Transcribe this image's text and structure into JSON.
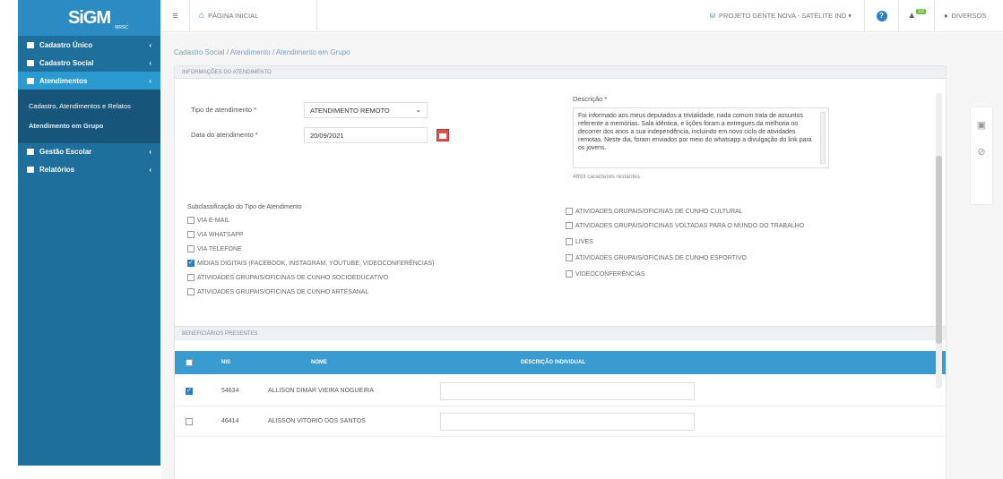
{
  "sidebar": {
    "logo": "SiGM",
    "logo_sub": "MRSC",
    "items": [
      {
        "label": "Cadastro Único",
        "chevron": "‹"
      },
      {
        "label": "Cadastro Social",
        "chevron": "‹"
      },
      {
        "label": "Atendimentos",
        "chevron": "‹"
      },
      {
        "label": "Gestão Escolar",
        "chevron": "‹"
      },
      {
        "label": "Relatórios",
        "chevron": "‹"
      }
    ],
    "submenu": [
      {
        "label": "Cadastro, Atendimentos e Relatos"
      },
      {
        "label": "Atendimento em Grupo"
      }
    ]
  },
  "topbar": {
    "menu_icon": "≡",
    "home_label": "PÁGINA INICIAL",
    "project_label": "PROJETO GENTE NOVA - SATÉLITE IND ▾",
    "notif_count": "12",
    "user_label": "DIVERSOS"
  },
  "breadcrumb": "Cadastro Social / Atendimento / Atendimento em Grupo",
  "form": {
    "section_title": "INFORMAÇÕES DO ATENDIMENTO",
    "tipo_label": "Tipo de atendimento *",
    "tipo_value": "ATENDIMENTO REMOTO",
    "data_label": "Data do atendimento *",
    "data_value": "20/09/2021",
    "descricao_label": "Descrição *",
    "descricao_value": "Foi informado aos meus deputados a trivialidade, nada comum trata de assuntos referente a memórias. Sala idêntica, e lições foram a entregues da melhoria no decorrer dos anos a sua independência, incluindo em novo ciclo de atividades remotas. Neste dia, foram enviados por meio do whatsapp a divulgação do link para os jovens.",
    "counter": "4893 caracteres restantes",
    "modalidades_label": "Subclassificação do Tipo de Atendimento",
    "options_left": [
      {
        "label": "VIA E-MAIL",
        "checked": false
      },
      {
        "label": "VIA WHATSAPP",
        "checked": false
      },
      {
        "label": "VIA TELEFONE",
        "checked": false
      },
      {
        "label": "MÍDIAS DIGITAIS (FACEBOOK, INSTAGRAM, YOUTUBE, VIDEOCONFERÊNCIAS)",
        "checked": true
      },
      {
        "label": "ATIVIDADES GRUPAIS/OFICINAS DE CUNHO SOCIOEDUCATIVO",
        "checked": false
      },
      {
        "label": "ATIVIDADES GRUPAIS/OFICINAS DE CUNHO ARTESANAL",
        "checked": false
      }
    ],
    "options_right": [
      {
        "label": "ATIVIDADES GRUPAIS/OFICINAS DE CUNHO CULTURAL",
        "checked": false
      },
      {
        "label": "ATIVIDADES GRUPAIS/OFICINAS VOLTADAS PARA O MUNDO DO TRABALHO",
        "checked": false
      },
      {
        "label": "LIVES",
        "checked": false
      },
      {
        "label": "ATIVIDADES GRUPAIS/OFICINAS DE CUNHO ESPORTIVO",
        "checked": false
      },
      {
        "label": "VIDEOCONFERÊNCIAS",
        "checked": false
      }
    ]
  },
  "beneficiarios": {
    "section_title": "BENEFICIÁRIOS PRESENTES",
    "columns": [
      "NIS",
      "NOME",
      "DESCRIÇÃO INDIVIDUAL"
    ],
    "rows": [
      {
        "checked": true,
        "nis": "54634",
        "nome": "ALLISON DIMAR VIEIRA NOGUEIRA"
      },
      {
        "checked": false,
        "nis": "46414",
        "nome": "ALISSON VITÓRIO DOS SANTOS"
      }
    ]
  }
}
